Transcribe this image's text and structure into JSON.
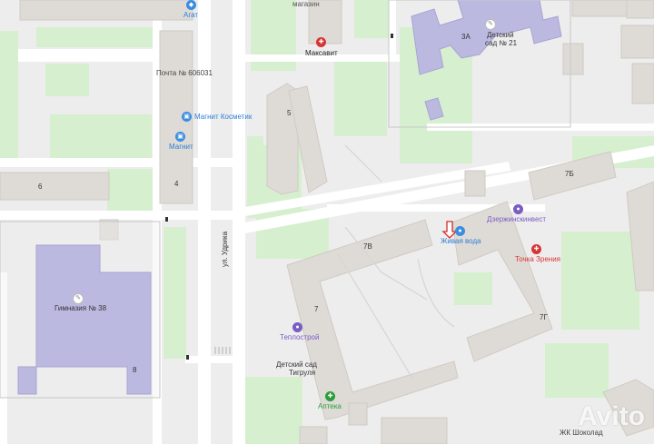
{
  "map": {
    "streets": {
      "udrika": "ул. Удрика"
    },
    "house_numbers": {
      "h4": "4",
      "h5": "5",
      "h6": "6",
      "h7": "7",
      "h7b": "7Б",
      "h7v": "7В",
      "h7g": "7Г",
      "h8": "8",
      "h3a": "3А"
    },
    "pois": {
      "magazin": "магазин",
      "agat": "Агат",
      "maksavit": "Максавит",
      "pochta": "Почта № 606031",
      "magnit_kosmetik": "Магнит Косметик",
      "magnit": "Магнит",
      "detsad21_line1": "Детский",
      "detsad21_line2": "сад № 21",
      "dzerzhinskinvest": "Дзержинскинвест",
      "zhivaya_voda": "Живая вода",
      "tochka_zreniya": "Точка Зрения",
      "gimnaziya": "Гимназия № 38",
      "teplostroy": "Теплострой",
      "detsad_tigrulya_line1": "Детский сад",
      "detsad_tigrulya_line2": "Тигруля",
      "apteka": "Аптека",
      "zhk_shokolad": "ЖК Шоколад"
    },
    "watermark": "Avito",
    "colors": {
      "background": "#eeeded",
      "green_area": "#d6efcf",
      "building": "#dedbd6",
      "school": "#bcb9e0",
      "road": "#ffffff",
      "marker": "#d42b22"
    }
  }
}
